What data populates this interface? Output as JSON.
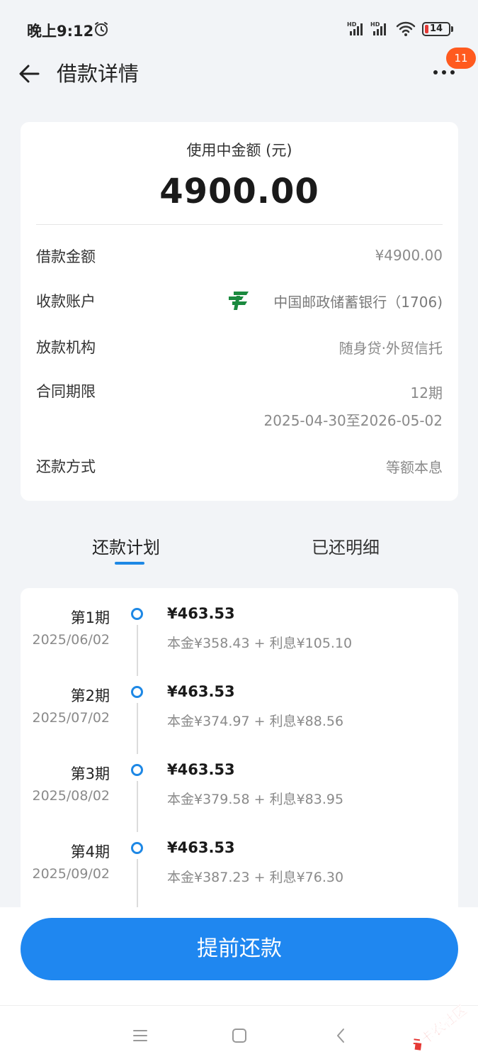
{
  "status_bar": {
    "time": "晚上9:12",
    "battery": "14"
  },
  "header": {
    "title": "借款详情",
    "badge_count": "11"
  },
  "summary": {
    "amount_label": "使用中金额 (元)",
    "amount_value": "4900.00",
    "rows": [
      {
        "label": "借款金额",
        "value": "¥4900.00"
      },
      {
        "label": "收款账户",
        "value": "中国邮政储蓄银行（1706)"
      },
      {
        "label": "放款机构",
        "value": "随身贷·外贸信托"
      },
      {
        "label": "合同期限",
        "value": "12期",
        "value2": "2025-04-30至2026-05-02"
      },
      {
        "label": "还款方式",
        "value": "等额本息"
      }
    ]
  },
  "tabs": [
    {
      "label": "还款计划",
      "active": true
    },
    {
      "label": "已还明细",
      "active": false
    }
  ],
  "plan": [
    {
      "name": "第1期",
      "date": "2025/06/02",
      "amount": "¥463.53",
      "breakdown": "本金¥358.43 + 利息¥105.10"
    },
    {
      "name": "第2期",
      "date": "2025/07/02",
      "amount": "¥463.53",
      "breakdown": "本金¥374.97 + 利息¥88.56"
    },
    {
      "name": "第3期",
      "date": "2025/08/02",
      "amount": "¥463.53",
      "breakdown": "本金¥379.58 + 利息¥83.95"
    },
    {
      "name": "第4期",
      "date": "2025/09/02",
      "amount": "¥463.53",
      "breakdown": "本金¥387.23 + 利息¥76.30"
    }
  ],
  "actions": {
    "prepay_label": "提前还款"
  },
  "watermark": "卡农社区",
  "colors": {
    "accent": "#1e88e5",
    "button": "#1f87f0",
    "badge": "#ff5a1f",
    "bank_logo": "#1b8a3f"
  }
}
